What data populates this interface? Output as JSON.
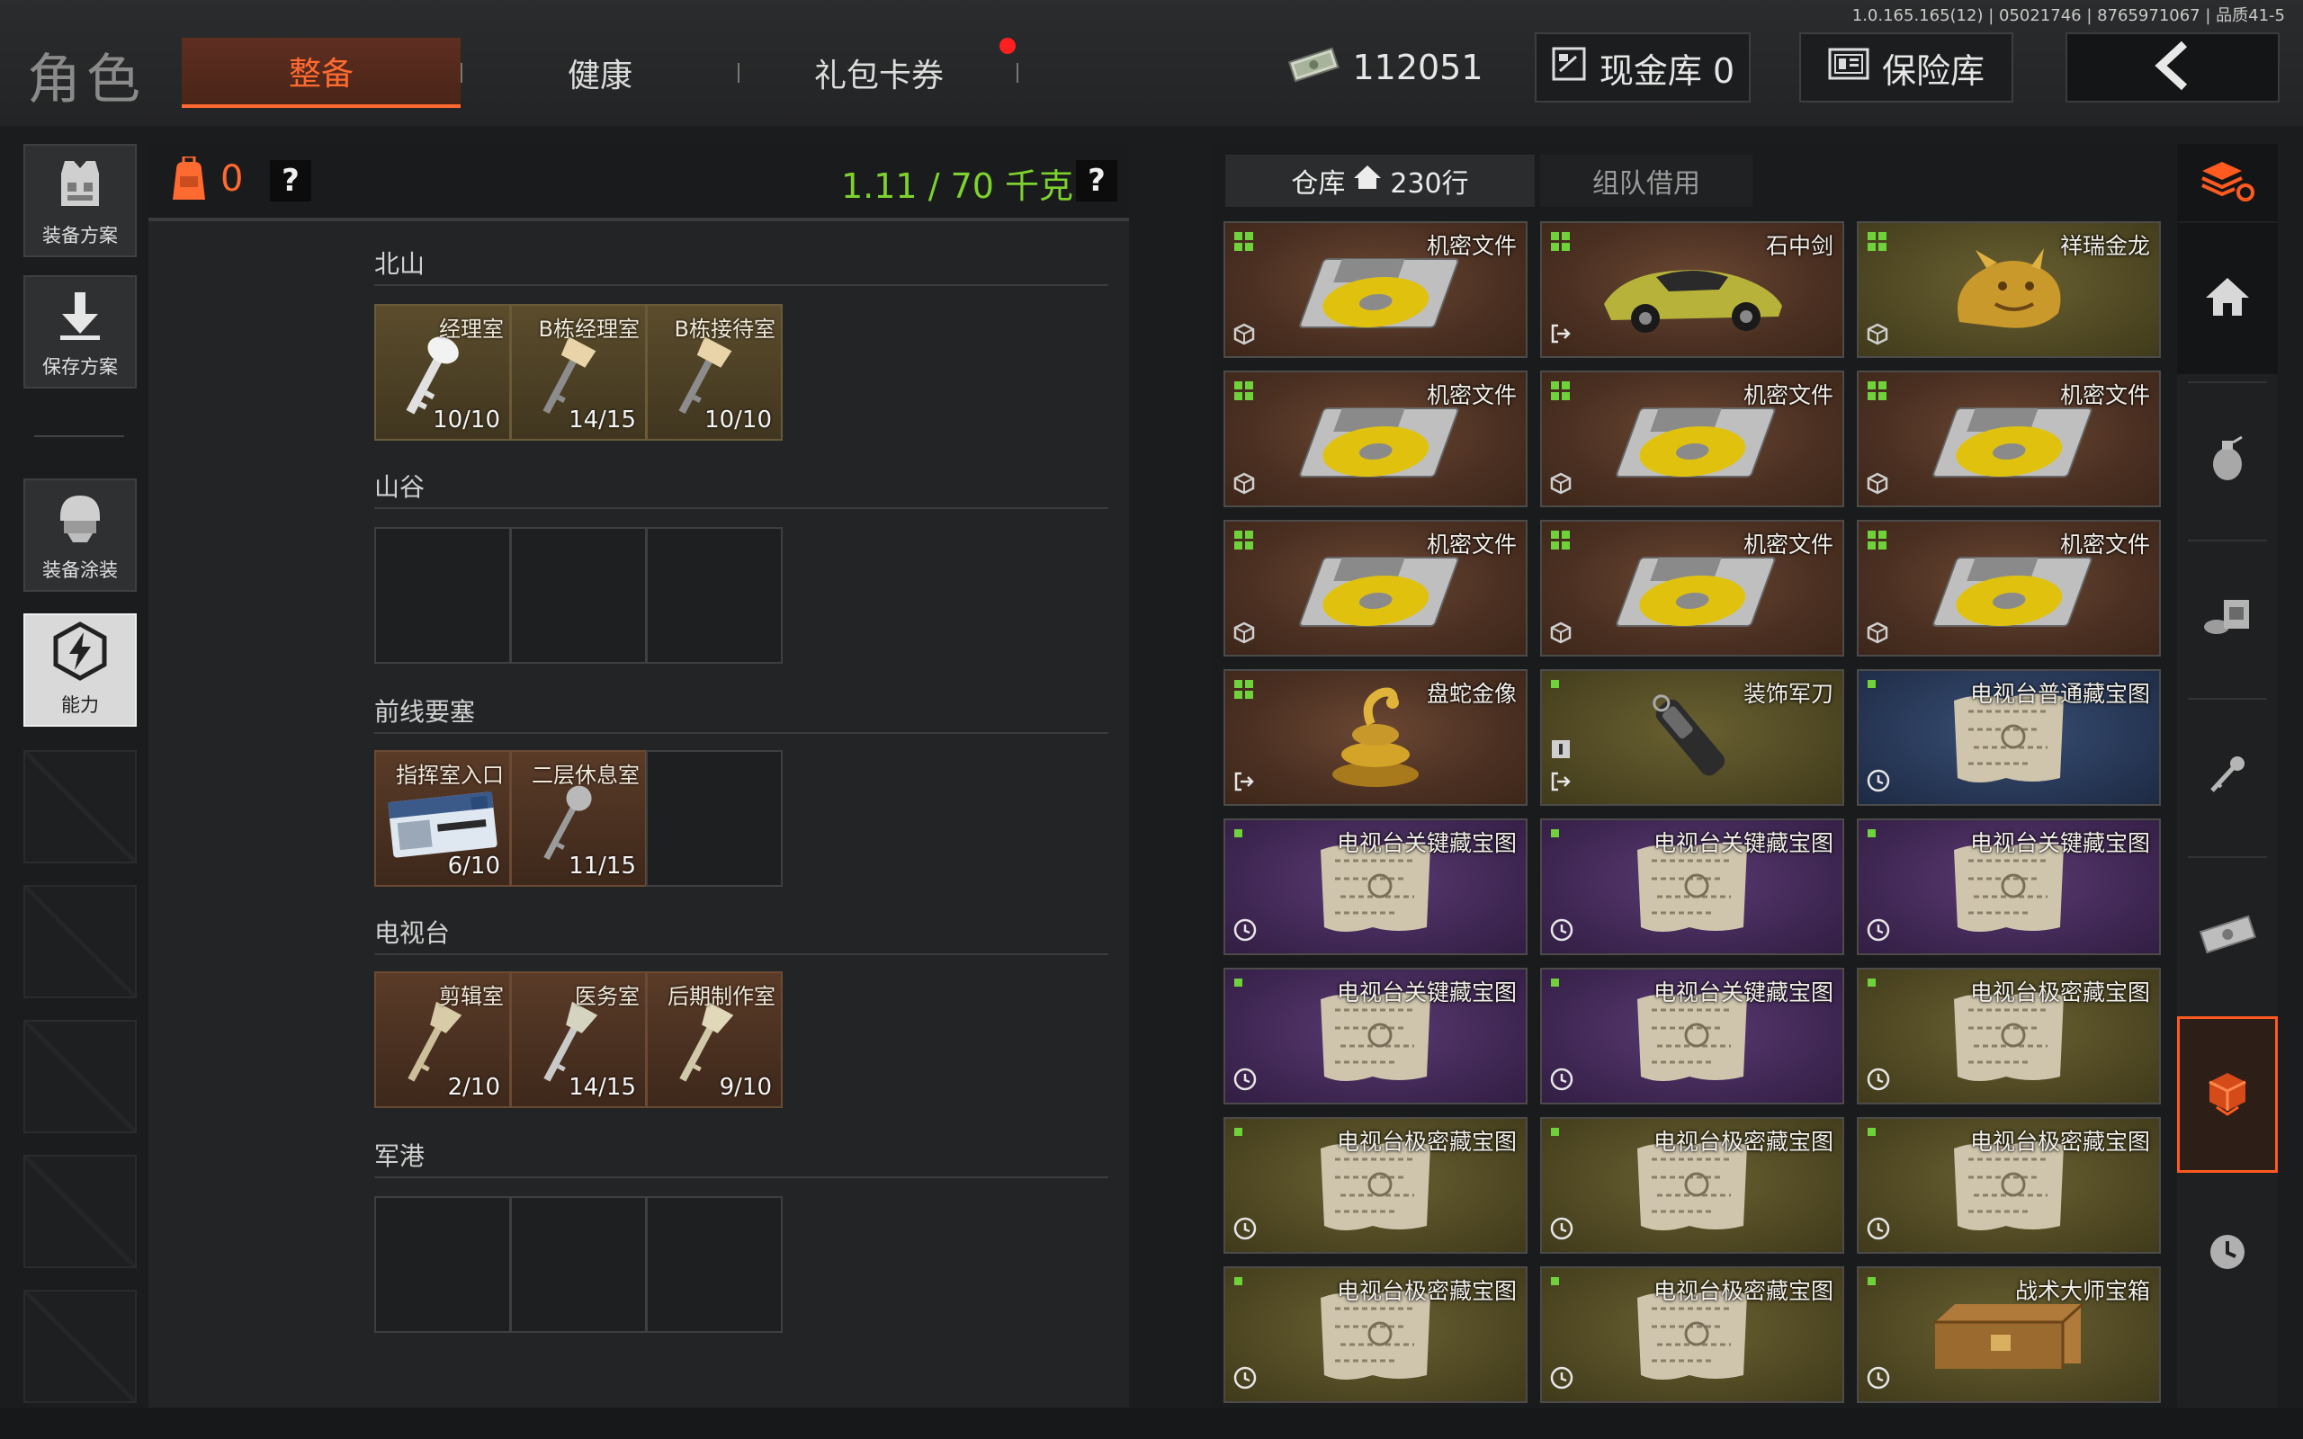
{
  "version_text": "1.0.165.165(12) | 05021746 | 8765971067 | 品质41-5",
  "header": {
    "title": "角色",
    "tabs": [
      {
        "label": "整备",
        "active": true
      },
      {
        "label": "健康",
        "active": false
      },
      {
        "label": "礼包卡券",
        "active": false
      }
    ],
    "money": "112051",
    "cash_vault": "现金库 0",
    "safe_box": "保险库"
  },
  "sidebar": {
    "buttons": [
      "装备方案",
      "保存方案",
      "装备涂装",
      "能力"
    ]
  },
  "loadout": {
    "bag_count": "0",
    "help": "?",
    "weight": "1.11 / 70 千克",
    "categories": [
      {
        "name": "北山",
        "keys": [
          {
            "name": "经理室",
            "count": "10/10"
          },
          {
            "name": "B栋经理室",
            "count": "14/15"
          },
          {
            "name": "B栋接待室",
            "count": "10/10"
          }
        ]
      },
      {
        "name": "山谷",
        "keys": []
      },
      {
        "name": "前线要塞",
        "keys": [
          {
            "name": "指挥室入口",
            "count": "6/10"
          },
          {
            "name": "二层休息室",
            "count": "11/15"
          }
        ]
      },
      {
        "name": "电视台",
        "keys": [
          {
            "name": "剪辑室",
            "count": "2/10"
          },
          {
            "name": "医务室",
            "count": "14/15"
          },
          {
            "name": "后期制作室",
            "count": "9/10"
          }
        ]
      },
      {
        "name": "军港",
        "keys": []
      }
    ]
  },
  "warehouse": {
    "tab_active": "仓库",
    "rows": "230行",
    "tab_inactive": "组队借用",
    "items": [
      {
        "name": "机密文件",
        "icon": "disk-icon",
        "color": "brown"
      },
      {
        "name": "石中剑",
        "icon": "supercar-icon",
        "color": "brown"
      },
      {
        "name": "祥瑞金龙",
        "icon": "golden-dragon-icon",
        "color": "olive"
      },
      {
        "name": "机密文件",
        "icon": "disk-icon",
        "color": "brown"
      },
      {
        "name": "机密文件",
        "icon": "disk-icon",
        "color": "brown"
      },
      {
        "name": "机密文件",
        "icon": "disk-icon",
        "color": "brown"
      },
      {
        "name": "机密文件",
        "icon": "disk-icon",
        "color": "brown"
      },
      {
        "name": "机密文件",
        "icon": "disk-icon",
        "color": "brown"
      },
      {
        "name": "机密文件",
        "icon": "disk-icon",
        "color": "brown"
      },
      {
        "name": "盘蛇金像",
        "icon": "golden-snake-icon",
        "color": "brown"
      },
      {
        "name": "装饰军刀",
        "icon": "knife-icon",
        "color": "olive"
      },
      {
        "name": "电视台普通藏宝图",
        "icon": "treasure-map-icon",
        "color": "blue"
      },
      {
        "name": "电视台关键藏宝图",
        "icon": "treasure-map-icon",
        "color": "purple"
      },
      {
        "name": "电视台关键藏宝图",
        "icon": "treasure-map-icon",
        "color": "purple"
      },
      {
        "name": "电视台关键藏宝图",
        "icon": "treasure-map-icon",
        "color": "purple"
      },
      {
        "name": "电视台关键藏宝图",
        "icon": "treasure-map-icon",
        "color": "purple"
      },
      {
        "name": "电视台关键藏宝图",
        "icon": "treasure-map-icon",
        "color": "purple"
      },
      {
        "name": "电视台极密藏宝图",
        "icon": "treasure-map-icon",
        "color": "olive"
      },
      {
        "name": "电视台极密藏宝图",
        "icon": "treasure-map-icon",
        "color": "olive"
      },
      {
        "name": "电视台极密藏宝图",
        "icon": "treasure-map-icon",
        "color": "olive"
      },
      {
        "name": "电视台极密藏宝图",
        "icon": "treasure-map-icon",
        "color": "olive"
      },
      {
        "name": "电视台极密藏宝图",
        "icon": "treasure-map-icon",
        "color": "olive"
      },
      {
        "name": "电视台极密藏宝图",
        "icon": "treasure-map-icon",
        "color": "olive"
      },
      {
        "name": "战术大师宝箱",
        "icon": "treasure-chest-icon",
        "color": "olive"
      }
    ]
  },
  "colors": {
    "accent": "#ff6a30",
    "weight_green": "#7dd22e",
    "grade_green": "#6fd23a"
  }
}
